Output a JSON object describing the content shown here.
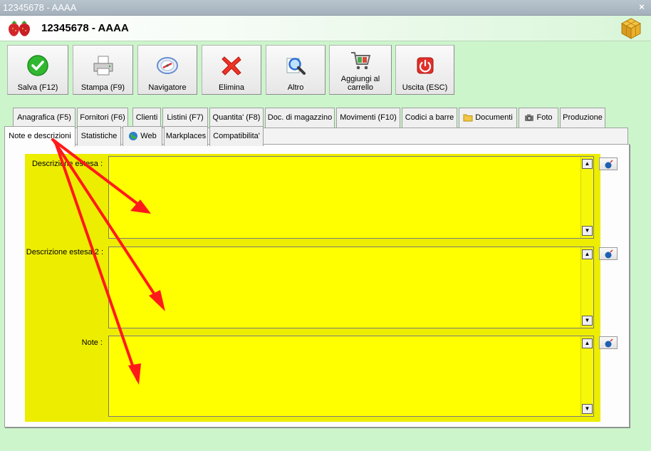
{
  "window": {
    "title": "12345678 - AAAA",
    "close_glyph": "×"
  },
  "header": {
    "title": "12345678 - AAAA",
    "app_icon": "strawberry-icon",
    "right_icon": "cube-icon"
  },
  "toolbar": {
    "buttons": [
      {
        "label": "Salva (F12)",
        "icon": "check-icon",
        "color": "#2fb82f"
      },
      {
        "label": "Stampa (F9)",
        "icon": "printer-icon",
        "color": "#7a7a7a"
      },
      {
        "label": "Navigatore",
        "icon": "compass-icon",
        "color": "#6a8fcf"
      },
      {
        "label": "Elimina",
        "icon": "delete-x-icon",
        "color": "#e8281e"
      },
      {
        "label": "Altro",
        "icon": "magnifier-icon",
        "color": "#2a6fd6"
      },
      {
        "label": "Aggiungi al carrello",
        "icon": "cart-icon",
        "color": "#7a7a7a"
      },
      {
        "label": "Uscita (ESC)",
        "icon": "power-icon",
        "color": "#e0302a"
      }
    ]
  },
  "tabs_row1": [
    {
      "label": "Anagrafica (F5)"
    },
    {
      "label": "Fornitori (F6)"
    },
    {
      "label": "Clienti"
    },
    {
      "label": "Listini (F7)"
    },
    {
      "label": "Quantita' (F8)"
    },
    {
      "label": "Doc. di magazzino"
    },
    {
      "label": "Movimenti (F10)"
    },
    {
      "label": "Codici a barre"
    },
    {
      "label": "Documenti",
      "icon": "folder-icon"
    },
    {
      "label": "Foto",
      "icon": "camera-icon"
    },
    {
      "label": "Produzione"
    }
  ],
  "tabs_row2": [
    {
      "label": "Note e descrizioni",
      "active": true
    },
    {
      "label": "Statistiche"
    },
    {
      "label": "Web",
      "icon": "globe-icon"
    },
    {
      "label": "Markplaces"
    },
    {
      "label": "Compatibilita'"
    }
  ],
  "fields": [
    {
      "label": "Descrizione estesa :",
      "value": ""
    },
    {
      "label": "Descrizione estesa 2 :",
      "value": ""
    },
    {
      "label": "Note :",
      "value": ""
    }
  ],
  "colors": {
    "highlight": "#ffff00",
    "frame": "#eded00",
    "annotation_arrow": "#ff0000",
    "background": "#ccf5cc"
  }
}
